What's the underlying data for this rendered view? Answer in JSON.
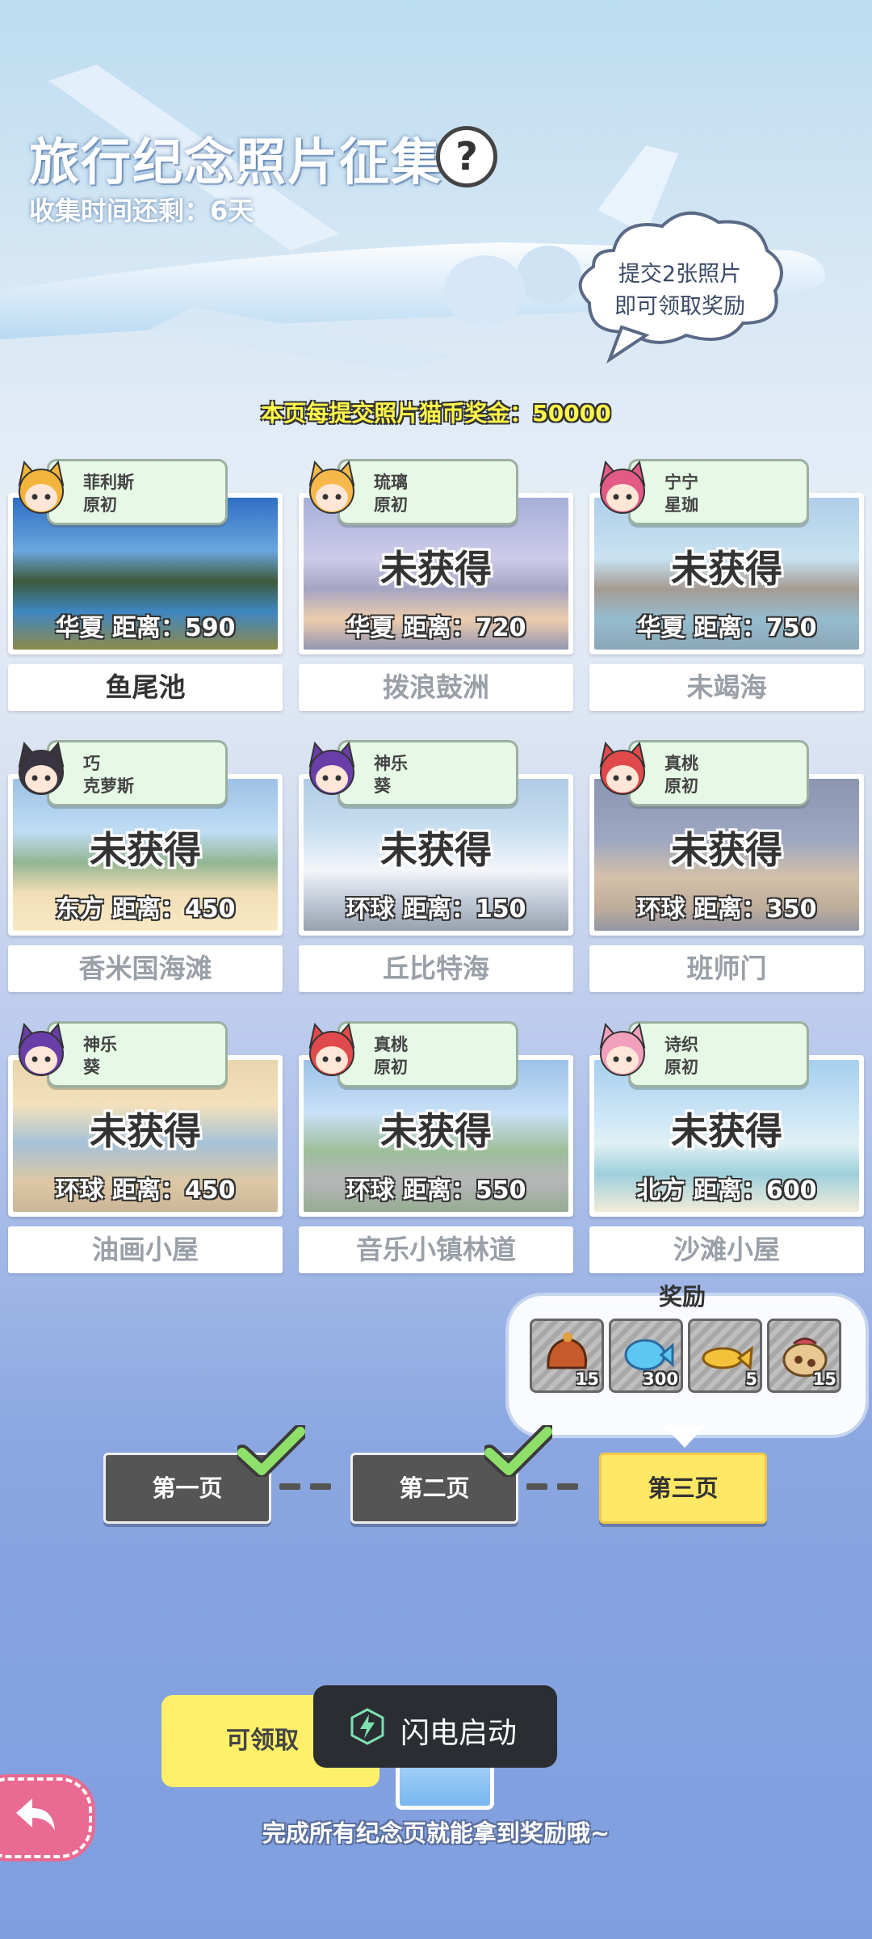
{
  "header": {
    "title": "旅行纪念照片征集",
    "help_icon": "question-mark",
    "time_left": "收集时间还剩：6天",
    "hint_line1": "提交2张照片",
    "hint_line2": "即可领取奖励",
    "bonus": "本页每提交照片猫币奖金：50000"
  },
  "cards": [
    {
      "char_line1": "菲利斯",
      "char_line2": "原初",
      "status": "",
      "distance": "华夏  距离：590",
      "place": "鱼尾池",
      "obtained": true
    },
    {
      "char_line1": "琉璃",
      "char_line2": "原初",
      "status": "未获得",
      "distance": "华夏  距离：720",
      "place": "拨浪鼓洲",
      "obtained": false
    },
    {
      "char_line1": "宁宁",
      "char_line2": "星珈",
      "status": "未获得",
      "distance": "华夏  距离：750",
      "place": "未竭海",
      "obtained": false
    },
    {
      "char_line1": "巧",
      "char_line2": "克萝斯",
      "status": "未获得",
      "distance": "东方  距离：450",
      "place": "香米国海滩",
      "obtained": false
    },
    {
      "char_line1": "神乐",
      "char_line2": "葵",
      "status": "未获得",
      "distance": "环球  距离：150",
      "place": "丘比特海",
      "obtained": false
    },
    {
      "char_line1": "真桃",
      "char_line2": "原初",
      "status": "未获得",
      "distance": "环球  距离：350",
      "place": "班师门",
      "obtained": false
    },
    {
      "char_line1": "神乐",
      "char_line2": "葵",
      "status": "未获得",
      "distance": "环球  距离：450",
      "place": "油画小屋",
      "obtained": false
    },
    {
      "char_line1": "真桃",
      "char_line2": "原初",
      "status": "未获得",
      "distance": "环球  距离：550",
      "place": "音乐小镇林道",
      "obtained": false
    },
    {
      "char_line1": "诗织",
      "char_line2": "原初",
      "status": "未获得",
      "distance": "北方  距离：600",
      "place": "沙滩小屋",
      "obtained": false
    }
  ],
  "rewards": {
    "title": "奖励",
    "items": [
      {
        "icon": "food-bag-icon",
        "count": "15"
      },
      {
        "icon": "blue-fish-icon",
        "count": "300"
      },
      {
        "icon": "golden-fish-icon",
        "count": "5"
      },
      {
        "icon": "pouch-icon",
        "count": "15"
      }
    ]
  },
  "pages": {
    "page1": "第一页",
    "page2": "第二页",
    "page3": "第三页",
    "page1_done": true,
    "page2_done": true
  },
  "bottom": {
    "claim_label": "可领取",
    "toast_text": "闪电启动",
    "footer_text": "完成所有纪念页就能拿到奖励哦~"
  },
  "colors": {
    "bonus_text": "#fff64a",
    "active_page": "#ffe866",
    "tag_bg": "#e6f8e6",
    "back_button": "#e96a92"
  }
}
